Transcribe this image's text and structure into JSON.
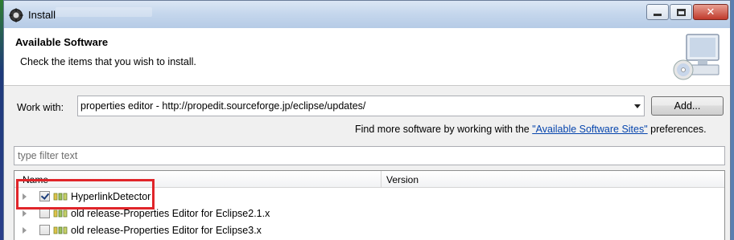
{
  "window": {
    "title": "Install"
  },
  "header": {
    "title": "Available Software",
    "description": "Check the items that you wish to install."
  },
  "work_with": {
    "label": "Work with:",
    "value": "properties editor - http://propedit.sourceforge.jp/eclipse/updates/",
    "add_button": "Add..."
  },
  "find_more": {
    "prefix": "Find more software by working with the ",
    "link": "\"Available Software Sites\"",
    "suffix": " preferences."
  },
  "filter": {
    "placeholder": "type filter text"
  },
  "tree": {
    "columns": [
      "Name",
      "Version"
    ],
    "rows": [
      {
        "label": "HyperlinkDetector",
        "checked": true
      },
      {
        "label": "old release-Properties Editor for Eclipse2.1.x",
        "checked": false
      },
      {
        "label": "old release-Properties Editor for Eclipse3.x",
        "checked": false
      }
    ]
  },
  "icons": {
    "app": "eclipse-install-icon",
    "banner": "computer-cd-icon",
    "package": "feature-package-icon"
  },
  "colors": {
    "highlight": "#e0252a",
    "link": "#0645ad"
  }
}
